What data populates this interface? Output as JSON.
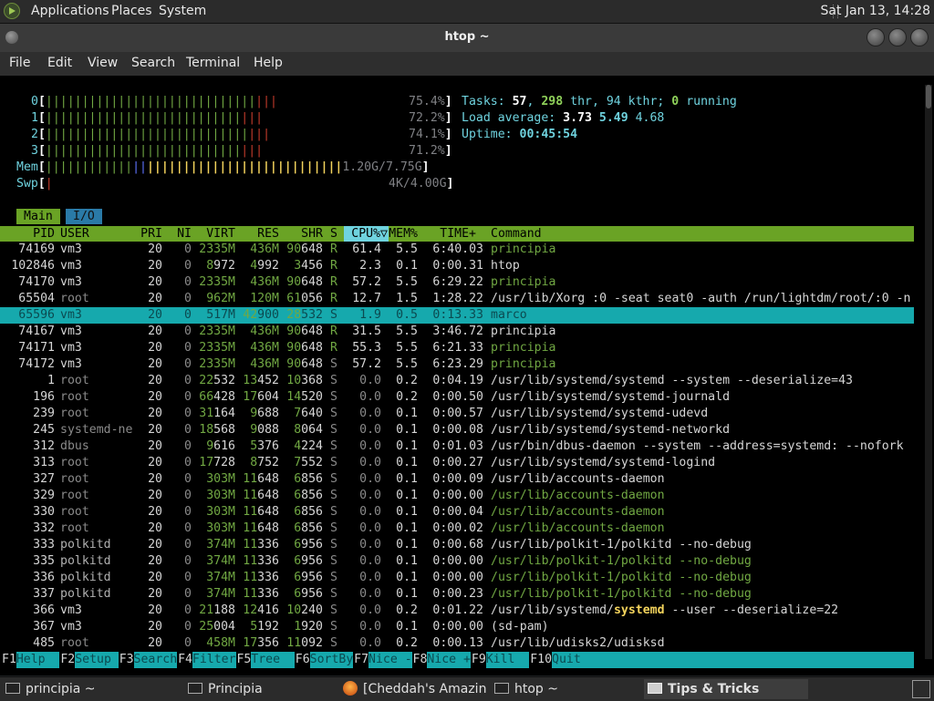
{
  "panel": {
    "menus": [
      "Applications",
      "Places",
      "System"
    ],
    "clock": "Sat Jan 13, 14:28"
  },
  "window": {
    "title": "htop ~"
  },
  "menubar": [
    "File",
    "Edit",
    "View",
    "Search",
    "Terminal",
    "Help"
  ],
  "meters": {
    "cpus": [
      {
        "label": "0",
        "percent": 75.4,
        "text": "75.4%"
      },
      {
        "label": "1",
        "percent": 72.2,
        "text": "72.2%"
      },
      {
        "label": "2",
        "percent": 74.1,
        "text": "74.1%"
      },
      {
        "label": "3",
        "percent": 71.2,
        "text": "71.2%"
      }
    ],
    "mem": {
      "label": "Mem",
      "text": "1.20G/7.75G"
    },
    "swp": {
      "label": "Swp",
      "text": "4K/4.00G"
    }
  },
  "summary": {
    "tasks_label": "Tasks: ",
    "tasks": "57",
    "thr": "298",
    "thr_label": " thr, ",
    "kthr": "94 kthr",
    "running": "0",
    "running_label": " running",
    "load_label": "Load average: ",
    "load1": "3.73",
    "load5": "5.49",
    "load15": "4.68",
    "uptime_label": "Uptime: ",
    "uptime": "00:45:54"
  },
  "tabs": [
    "Main",
    "I/O"
  ],
  "columns": [
    "PID",
    "USER",
    "PRI",
    "NI",
    "VIRT",
    "RES",
    "SHR",
    "S",
    "CPU%▽",
    "MEM%",
    "TIME+",
    "Command"
  ],
  "processes": [
    {
      "pid": "74169",
      "user": "vm3",
      "pri": "20",
      "ni": "0",
      "virt": "2335M",
      "res": "436M",
      "shr": "90648",
      "s": "R",
      "cpu": "61.4",
      "mem": "5.5",
      "time": "6:40.03",
      "cmd": "principia",
      "style": "thread"
    },
    {
      "pid": "102846",
      "user": "vm3",
      "pri": "20",
      "ni": "0",
      "virt": "8972",
      "res": "4992",
      "shr": "3456",
      "s": "R",
      "cpu": "2.3",
      "mem": "0.1",
      "time": "0:00.31",
      "cmd": "htop",
      "style": "normal"
    },
    {
      "pid": "74170",
      "user": "vm3",
      "pri": "20",
      "ni": "0",
      "virt": "2335M",
      "res": "436M",
      "shr": "90648",
      "s": "R",
      "cpu": "57.2",
      "mem": "5.5",
      "time": "6:29.22",
      "cmd": "principia",
      "style": "thread"
    },
    {
      "pid": "65504",
      "user": "root",
      "pri": "20",
      "ni": "0",
      "virt": "962M",
      "res": "120M",
      "shr": "61056",
      "s": "R",
      "cpu": "12.7",
      "mem": "1.5",
      "time": "1:28.22",
      "cmd": "/usr/lib/Xorg :0 -seat seat0 -auth /run/lightdm/root/:0 -n",
      "style": "normal"
    },
    {
      "pid": "65596",
      "user": "vm3",
      "pri": "20",
      "ni": "0",
      "virt": "517M",
      "res": "42900",
      "shr": "28532",
      "s": "S",
      "cpu": "1.9",
      "mem": "0.5",
      "time": "0:13.33",
      "cmd": "marco",
      "style": "selected"
    },
    {
      "pid": "74167",
      "user": "vm3",
      "pri": "20",
      "ni": "0",
      "virt": "2335M",
      "res": "436M",
      "shr": "90648",
      "s": "R",
      "cpu": "31.5",
      "mem": "5.5",
      "time": "3:46.72",
      "cmd": "principia",
      "style": "normal"
    },
    {
      "pid": "74171",
      "user": "vm3",
      "pri": "20",
      "ni": "0",
      "virt": "2335M",
      "res": "436M",
      "shr": "90648",
      "s": "R",
      "cpu": "55.3",
      "mem": "5.5",
      "time": "6:21.33",
      "cmd": "principia",
      "style": "thread"
    },
    {
      "pid": "74172",
      "user": "vm3",
      "pri": "20",
      "ni": "0",
      "virt": "2335M",
      "res": "436M",
      "shr": "90648",
      "s": "S",
      "cpu": "57.2",
      "mem": "5.5",
      "time": "6:23.29",
      "cmd": "principia",
      "style": "thread"
    },
    {
      "pid": "1",
      "user": "root",
      "pri": "20",
      "ni": "0",
      "virt": "22532",
      "res": "13452",
      "shr": "10368",
      "s": "S",
      "cpu": "0.0",
      "mem": "0.2",
      "time": "0:04.19",
      "cmd": "/usr/lib/systemd/systemd --system --deserialize=43",
      "style": "normal"
    },
    {
      "pid": "196",
      "user": "root",
      "pri": "20",
      "ni": "0",
      "virt": "66428",
      "res": "17604",
      "shr": "14520",
      "s": "S",
      "cpu": "0.0",
      "mem": "0.2",
      "time": "0:00.50",
      "cmd": "/usr/lib/systemd/systemd-journald",
      "style": "normal"
    },
    {
      "pid": "239",
      "user": "root",
      "pri": "20",
      "ni": "0",
      "virt": "31164",
      "res": "9688",
      "shr": "7640",
      "s": "S",
      "cpu": "0.0",
      "mem": "0.1",
      "time": "0:00.57",
      "cmd": "/usr/lib/systemd/systemd-udevd",
      "style": "normal"
    },
    {
      "pid": "245",
      "user": "systemd-ne",
      "pri": "20",
      "ni": "0",
      "virt": "18568",
      "res": "9088",
      "shr": "8064",
      "s": "S",
      "cpu": "0.0",
      "mem": "0.1",
      "time": "0:00.08",
      "cmd": "/usr/lib/systemd/systemd-networkd",
      "style": "normal"
    },
    {
      "pid": "312",
      "user": "dbus",
      "pri": "20",
      "ni": "0",
      "virt": "9616",
      "res": "5376",
      "shr": "4224",
      "s": "S",
      "cpu": "0.0",
      "mem": "0.1",
      "time": "0:01.03",
      "cmd": "/usr/bin/dbus-daemon --system --address=systemd: --nofork",
      "style": "normal"
    },
    {
      "pid": "313",
      "user": "root",
      "pri": "20",
      "ni": "0",
      "virt": "17728",
      "res": "8752",
      "shr": "7552",
      "s": "S",
      "cpu": "0.0",
      "mem": "0.1",
      "time": "0:00.27",
      "cmd": "/usr/lib/systemd/systemd-logind",
      "style": "normal"
    },
    {
      "pid": "327",
      "user": "root",
      "pri": "20",
      "ni": "0",
      "virt": "303M",
      "res": "11648",
      "shr": "6856",
      "s": "S",
      "cpu": "0.0",
      "mem": "0.1",
      "time": "0:00.09",
      "cmd": "/usr/lib/accounts-daemon",
      "style": "normal"
    },
    {
      "pid": "329",
      "user": "root",
      "pri": "20",
      "ni": "0",
      "virt": "303M",
      "res": "11648",
      "shr": "6856",
      "s": "S",
      "cpu": "0.0",
      "mem": "0.1",
      "time": "0:00.00",
      "cmd": "/usr/lib/accounts-daemon",
      "style": "thread"
    },
    {
      "pid": "330",
      "user": "root",
      "pri": "20",
      "ni": "0",
      "virt": "303M",
      "res": "11648",
      "shr": "6856",
      "s": "S",
      "cpu": "0.0",
      "mem": "0.1",
      "time": "0:00.04",
      "cmd": "/usr/lib/accounts-daemon",
      "style": "thread"
    },
    {
      "pid": "332",
      "user": "root",
      "pri": "20",
      "ni": "0",
      "virt": "303M",
      "res": "11648",
      "shr": "6856",
      "s": "S",
      "cpu": "0.0",
      "mem": "0.1",
      "time": "0:00.02",
      "cmd": "/usr/lib/accounts-daemon",
      "style": "thread"
    },
    {
      "pid": "333",
      "user": "polkitd",
      "pri": "20",
      "ni": "0",
      "virt": "374M",
      "res": "11336",
      "shr": "6956",
      "s": "S",
      "cpu": "0.0",
      "mem": "0.1",
      "time": "0:00.68",
      "cmd": "/usr/lib/polkit-1/polkitd --no-debug",
      "style": "normal"
    },
    {
      "pid": "335",
      "user": "polkitd",
      "pri": "20",
      "ni": "0",
      "virt": "374M",
      "res": "11336",
      "shr": "6956",
      "s": "S",
      "cpu": "0.0",
      "mem": "0.1",
      "time": "0:00.00",
      "cmd": "/usr/lib/polkit-1/polkitd --no-debug",
      "style": "thread"
    },
    {
      "pid": "336",
      "user": "polkitd",
      "pri": "20",
      "ni": "0",
      "virt": "374M",
      "res": "11336",
      "shr": "6956",
      "s": "S",
      "cpu": "0.0",
      "mem": "0.1",
      "time": "0:00.00",
      "cmd": "/usr/lib/polkit-1/polkitd --no-debug",
      "style": "thread"
    },
    {
      "pid": "337",
      "user": "polkitd",
      "pri": "20",
      "ni": "0",
      "virt": "374M",
      "res": "11336",
      "shr": "6956",
      "s": "S",
      "cpu": "0.0",
      "mem": "0.1",
      "time": "0:00.23",
      "cmd": "/usr/lib/polkit-1/polkitd --no-debug",
      "style": "thread"
    },
    {
      "pid": "366",
      "user": "vm3",
      "pri": "20",
      "ni": "0",
      "virt": "21188",
      "res": "12416",
      "shr": "10240",
      "s": "S",
      "cpu": "0.0",
      "mem": "0.2",
      "time": "0:01.22",
      "cmd_pre": "/usr/lib/systemd/",
      "cmd_hl": "systemd",
      "cmd_post": " --user --deserialize=22",
      "style": "normal"
    },
    {
      "pid": "367",
      "user": "vm3",
      "pri": "20",
      "ni": "0",
      "virt": "25004",
      "res": "5192",
      "shr": "1920",
      "s": "S",
      "cpu": "0.0",
      "mem": "0.1",
      "time": "0:00.00",
      "cmd": "(sd-pam)",
      "style": "normal"
    },
    {
      "pid": "485",
      "user": "root",
      "pri": "20",
      "ni": "0",
      "virt": "458M",
      "res": "17356",
      "shr": "11092",
      "s": "S",
      "cpu": "0.0",
      "mem": "0.2",
      "time": "0:00.13",
      "cmd": "/usr/lib/udisks2/udisksd",
      "style": "normal"
    }
  ],
  "fkeys": [
    {
      "key": "F1",
      "label": "Help  "
    },
    {
      "key": "F2",
      "label": "Setup "
    },
    {
      "key": "F3",
      "label": "Search"
    },
    {
      "key": "F4",
      "label": "Filter"
    },
    {
      "key": "F5",
      "label": "Tree  "
    },
    {
      "key": "F6",
      "label": "SortBy"
    },
    {
      "key": "F7",
      "label": "Nice -"
    },
    {
      "key": "F8",
      "label": "Nice +"
    },
    {
      "key": "F9",
      "label": "Kill  "
    },
    {
      "key": "F10",
      "label": "Quit"
    }
  ],
  "taskbar": [
    {
      "label": "principia ~",
      "icon": "terminal-icon"
    },
    {
      "label": "Principia",
      "icon": "window-icon"
    },
    {
      "label": "[Cheddah's Amazin...",
      "icon": "firefox-icon"
    },
    {
      "label": "htop ~",
      "icon": "terminal-icon"
    },
    {
      "label": "Tips & Tricks",
      "icon": "window-icon"
    }
  ],
  "colors": {
    "green": "#71a843",
    "header_green": "#6aa325",
    "cyan": "#16a9ad",
    "red": "#c33b2b",
    "blue": "#5e74ff"
  }
}
